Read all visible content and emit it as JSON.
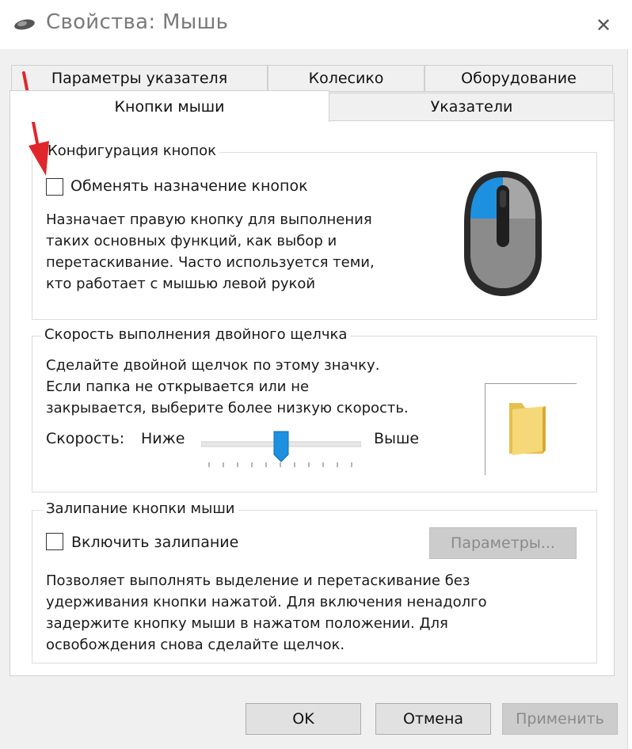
{
  "window": {
    "title": "Свойства: Мышь",
    "close_glyph": "✕"
  },
  "tabs": {
    "row_back": [
      {
        "label": "Параметры указателя"
      },
      {
        "label": "Колесико"
      },
      {
        "label": "Оборудование"
      }
    ],
    "row_front": [
      {
        "label": "Кнопки мыши",
        "active": true
      },
      {
        "label": "Указатели"
      }
    ]
  },
  "button_config": {
    "legend": "Конфигурация кнопок",
    "swap_label": "Обменять назначение кнопок",
    "swap_checked": false,
    "description": "Назначает правую кнопку для выполнения\nтаких основных функций, как выбор и\nперетаскивание. Часто используется теми,\nкто работает с мышью левой рукой"
  },
  "double_click": {
    "legend": "Скорость выполнения двойного щелчка",
    "description": "Сделайте двойной щелчок по этому значку.\nЕсли папка не открывается или не\nзакрывается, выберите более низкую скорость.",
    "speed_label": "Скорость:",
    "slow_label": "Ниже",
    "fast_label": "Выше",
    "slider_level": 0.5
  },
  "click_lock": {
    "legend": "Залипание кнопки мыши",
    "enable_label": "Включить залипание",
    "enable_checked": false,
    "settings_button": "Параметры...",
    "description": "Позволяет выполнять выделение и перетаскивание без\nудерживания кнопки нажатой. Для включения ненадолго\nзадержите кнопку мыши в нажатом положении. Для\nосвобождения снова сделайте щелчок."
  },
  "footer": {
    "ok": "OK",
    "cancel": "Отмена",
    "apply": "Применить"
  },
  "colors": {
    "accent_blue": "#1e90e0",
    "annotation_red": "#e0262b",
    "mouse_gray": "#8e8e8e",
    "folder_yellow": "#f3d36b"
  }
}
